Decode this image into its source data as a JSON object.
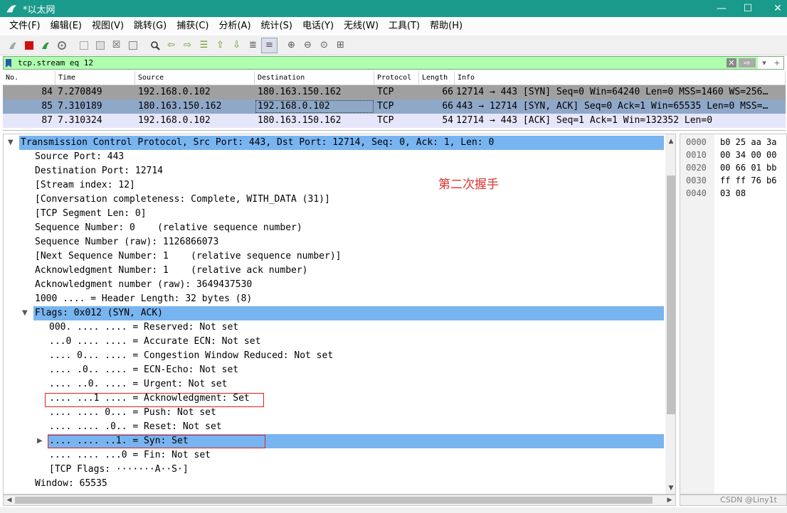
{
  "window": {
    "title": "*以太网",
    "minimize": "—",
    "maximize": "☐",
    "close": "✕"
  },
  "menu": [
    "文件(F)",
    "编辑(E)",
    "视图(V)",
    "跳转(G)",
    "捕获(C)",
    "分析(A)",
    "统计(S)",
    "电话(Y)",
    "无线(W)",
    "工具(T)",
    "帮助(H)"
  ],
  "filter": {
    "value": "tcp.stream eq 12",
    "clear": "✕",
    "apply": "⇨",
    "dropdown": "▾",
    "add": "+"
  },
  "packet_list": {
    "headers": [
      "No.",
      "Time",
      "Source",
      "Destination",
      "Protocol",
      "Length",
      "Info"
    ],
    "rows": [
      {
        "no": "84",
        "time": "7.270849",
        "src": "192.168.0.102",
        "dst": "180.163.150.162",
        "proto": "TCP",
        "len": "66",
        "info": "12714 → 443 [SYN] Seq=0 Win=64240 Len=0 MSS=1460 WS=256…",
        "bg": "#a0a0a0"
      },
      {
        "no": "85",
        "time": "7.310189",
        "src": "180.163.150.162",
        "dst": "192.168.0.102",
        "proto": "TCP",
        "len": "66",
        "info": "443 → 12714 [SYN, ACK] Seq=0 Ack=1 Win=65535 Len=0 MSS=…",
        "bg": "#8fa8c8"
      },
      {
        "no": "87",
        "time": "7.310324",
        "src": "192.168.0.102",
        "dst": "180.163.150.162",
        "proto": "TCP",
        "len": "54",
        "info": "12714 → 443 [ACK] Seq=1 Ack=1 Win=132352 Len=0",
        "bg": "#e6e6fa"
      }
    ]
  },
  "detail": {
    "annotation": "第二次握手",
    "lines": [
      "Transmission Control Protocol, Src Port: 443, Dst Port: 12714, Seq: 0, Ack: 1, Len: 0",
      "Source Port: 443",
      "Destination Port: 12714",
      "[Stream index: 12]",
      "[Conversation completeness: Complete, WITH_DATA (31)]",
      "[TCP Segment Len: 0]",
      "Sequence Number: 0    (relative sequence number)",
      "Sequence Number (raw): 1126866073",
      "[Next Sequence Number: 1    (relative sequence number)]",
      "Acknowledgment Number: 1    (relative ack number)",
      "Acknowledgment number (raw): 3649437530",
      "1000 .... = Header Length: 32 bytes (8)",
      "Flags: 0x012 (SYN, ACK)",
      "000. .... .... = Reserved: Not set",
      "...0 .... .... = Accurate ECN: Not set",
      ".... 0... .... = Congestion Window Reduced: Not set",
      ".... .0.. .... = ECN-Echo: Not set",
      ".... ..0. .... = Urgent: Not set",
      ".... ...1 .... = Acknowledgment: Set",
      ".... .... 0... = Push: Not set",
      ".... .... .0.. = Reset: Not set",
      ".... .... ..1. = Syn: Set",
      ".... .... ...0 = Fin: Not set",
      "[TCP Flags: ·······A··S·]",
      "Window: 65535"
    ]
  },
  "bytes": {
    "offsets": [
      "0000",
      "0010",
      "0020",
      "0030",
      "0040"
    ],
    "hex": [
      "b0 25 aa 3a",
      "00 34 00 00",
      "00 66 01 bb",
      "ff ff 76 b6",
      "03 08"
    ]
  },
  "watermark": "CSDN @Liny1t",
  "colors": {
    "titlebar": "#1a9a8a",
    "selection": "#78b4f0",
    "filter_ok": "#afffaf",
    "annotation": "#e03030"
  }
}
